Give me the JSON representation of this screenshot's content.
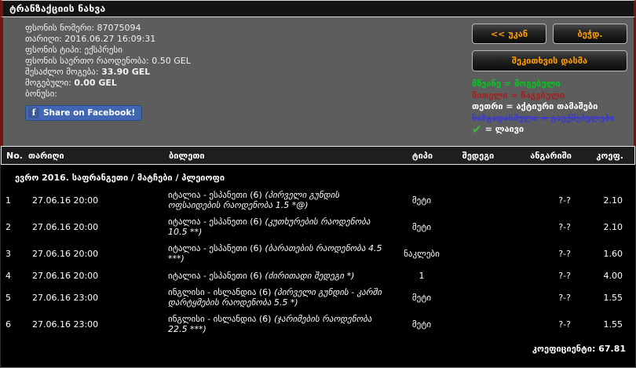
{
  "header": {
    "title": "ტრანზაქციის ნახვა"
  },
  "info": {
    "lines": [
      {
        "label": "ფსონის ნომერი:",
        "value": "87075094"
      },
      {
        "label": "თარიღი:",
        "value": "2016.06.27 16:09:31"
      },
      {
        "label": "ფსონის ტიპი:",
        "value": "ექსპრესი"
      },
      {
        "label": "ფსონის საერთო რაოდენობა:",
        "value": "0.50 GEL"
      },
      {
        "label": "შესაძლო მოგება:",
        "value": "33.90 GEL"
      },
      {
        "label": "მოგებული:",
        "value": "0.00 GEL"
      },
      {
        "label": "ბონუსი:",
        "value": ""
      }
    ],
    "facebook_share_label": "Share on Facebook!",
    "facebook_icon": "f"
  },
  "toolbar": {
    "back_label": "<< უკან",
    "print_label": "ბეჭდ.",
    "ask_question_label": "შეკითხვის დასმა"
  },
  "legend": {
    "won": "მწვანე = მოგებული",
    "lost": "წითელი = წაგებული",
    "active": "თეთრი = აქტიური თამაშები",
    "cancelled": "ხაზგადასმული = გაუქმებულები",
    "live_icon": "✔",
    "live": "= ლაივი"
  },
  "colors": {
    "won_green": "#00c71e",
    "lost_red": "#a32020",
    "active_white": "#ffffff",
    "cancelled_blue": "#3a3ad0",
    "button_text_orange": "#ff9c00",
    "facebook_blue": "#4267b2",
    "page_gray": "#5d5d5d",
    "side_stripe_maroon": "#6f1512"
  },
  "table": {
    "headers": [
      "No.",
      "თარიღი",
      "ბილეთი",
      "ტიპი",
      "შედეგი",
      "ანგარიში",
      "კოეფ."
    ],
    "section_header": "ევრო 2016. საფრანგეთი / მატჩები / პლეიოფი",
    "rows": [
      {
        "no": "1",
        "date": "27.06.16 20:00",
        "match": "იტალია - ესპანეთი (6)",
        "detail": "(პირველი გუნდის ოფსაიდების რაოდენობა 1.5  *@)",
        "type": "მეტი",
        "result": "",
        "score": "?-?",
        "coef": "2.10"
      },
      {
        "no": "2",
        "date": "27.06.16 20:00",
        "match": "იტალია - ესპანეთი (6)",
        "detail": "(კუთხურების რაოდენობა 10.5 **)",
        "type": "მეტი",
        "result": "",
        "score": "?-?",
        "coef": "2.10"
      },
      {
        "no": "3",
        "date": "27.06.16 20:00",
        "match": "იტალია - ესპანეთი (6)",
        "detail": "(ბარათების რაოდენობა 4.5 ***)",
        "type": "ნაკლები",
        "result": "",
        "score": "?-?",
        "coef": "1.60"
      },
      {
        "no": "4",
        "date": "27.06.16 20:00",
        "match": "იტალია - ესპანეთი (6)",
        "detail": "(ძირითადი შედეგი *)",
        "type": "1",
        "result": "",
        "score": "?-?",
        "coef": "4.00"
      },
      {
        "no": "5",
        "date": "27.06.16 23:00",
        "match": "ინგლისი - ისლანდია (6)",
        "detail": "(პირველი გუნდის - კარში დარტყმების რაოდენობა 5.5  *)",
        "type": "მეტი",
        "result": "",
        "score": "?-?",
        "coef": "1.55"
      },
      {
        "no": "6",
        "date": "27.06.16 23:00",
        "match": "ინგლისი - ისლანდია (6)",
        "detail": "(ჯარიმების რაოდენობა 22.5 ***)",
        "type": "მეტი",
        "result": "",
        "score": "?-?",
        "coef": "1.55"
      }
    ],
    "footer_label": "კოეფიციენტი:",
    "footer_value": "67.81"
  }
}
